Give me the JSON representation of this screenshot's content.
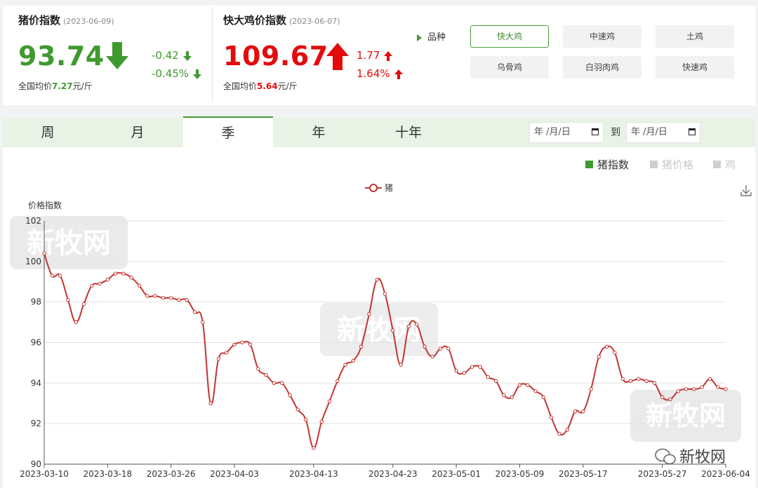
{
  "pig_index": {
    "title": "猪价指数",
    "date": "(2023-06-09)",
    "value": "93.74",
    "change_abs": "-0.42",
    "change_pct": "-0.45%",
    "avg_prefix": "全国均价",
    "avg_value": "7.27",
    "avg_unit": "元/斤",
    "color": "#3f9a2f"
  },
  "chicken_index": {
    "title": "快大鸡价指数",
    "date": "(2023-06-07)",
    "value": "109.67",
    "change_abs": "1.77",
    "change_pct": "1.64%",
    "avg_prefix": "全国均价",
    "avg_value": "5.64",
    "avg_unit": "元/斤",
    "color": "#e30c0c"
  },
  "breeds": {
    "label": "品种",
    "items": [
      "快大鸡",
      "中速鸡",
      "土鸡",
      "乌骨鸡",
      "白羽肉鸡",
      "快速鸡"
    ],
    "active": "快大鸡"
  },
  "tabs": {
    "items": [
      "周",
      "月",
      "季",
      "年",
      "十年"
    ],
    "active": "季"
  },
  "date_range": {
    "start_placeholder": "年 /月/日",
    "to_label": "到",
    "end_placeholder": "年 /月/日"
  },
  "legend_top": [
    {
      "label": "猪指数",
      "state": "on"
    },
    {
      "label": "猪价格",
      "state": "off"
    },
    {
      "label": "鸡",
      "state": "off"
    }
  ],
  "watermark": "新牧网",
  "chart_data": {
    "type": "line",
    "title": "",
    "ylabel": "价格指数",
    "xlabel": "",
    "ylim": [
      90,
      102
    ],
    "yticks": [
      90,
      92,
      94,
      96,
      98,
      100,
      102
    ],
    "grid": true,
    "legend_position": "top-center",
    "x_tick_labels": [
      "2023-03-10",
      "2023-03-18",
      "2023-03-26",
      "2023-04-03",
      "2023-04-13",
      "2023-04-23",
      "2023-05-01",
      "2023-05-09",
      "2023-05-17",
      "2023-05-27",
      "2023-06-04"
    ],
    "x_tick_positions": [
      0,
      8,
      16,
      24,
      34,
      44,
      52,
      60,
      68,
      78,
      86
    ],
    "series": [
      {
        "name": "猪",
        "color": "#c23531",
        "values": [
          100.4,
          99.3,
          99.3,
          98.1,
          97.0,
          97.9,
          98.8,
          98.9,
          99.1,
          99.4,
          99.4,
          99.2,
          98.8,
          98.3,
          98.3,
          98.2,
          98.2,
          98.1,
          98.1,
          97.5,
          97.0,
          93.0,
          95.2,
          95.5,
          95.9,
          96.0,
          95.9,
          94.7,
          94.4,
          94.0,
          94.0,
          93.4,
          92.7,
          92.2,
          90.8,
          92.1,
          93.1,
          94.1,
          94.9,
          95.1,
          95.8,
          97.4,
          99.1,
          98.4,
          96.6,
          94.9,
          96.8,
          96.9,
          95.8,
          95.3,
          95.7,
          95.7,
          94.6,
          94.5,
          94.8,
          94.8,
          94.3,
          94.1,
          93.4,
          93.3,
          93.9,
          93.9,
          93.6,
          93.3,
          92.3,
          91.5,
          91.7,
          92.6,
          92.6,
          93.7,
          95.3,
          95.8,
          95.5,
          94.2,
          94.1,
          94.2,
          94.1,
          94.0,
          93.3,
          93.2,
          93.6,
          93.7,
          93.7,
          93.8,
          94.2,
          93.8,
          93.7
        ]
      }
    ]
  }
}
